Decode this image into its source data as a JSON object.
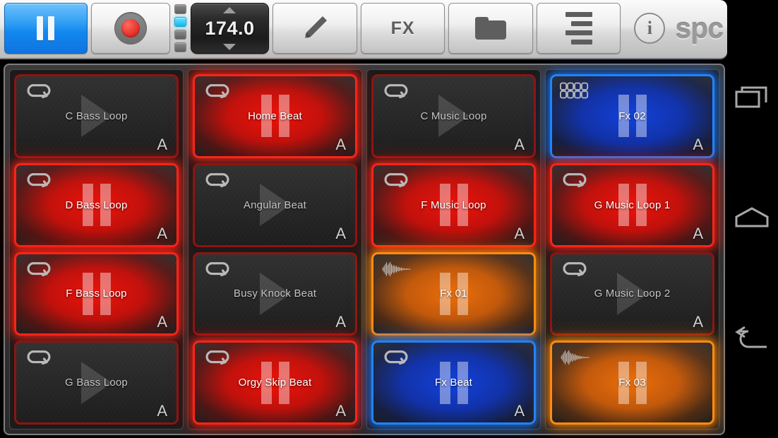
{
  "app": {
    "name": "SPC",
    "logo_text": "spc"
  },
  "toolbar": {
    "transport": {
      "play_pause_state": "pause",
      "play_pause_name": "pause-button",
      "record_name": "record-button"
    },
    "beat_leds": {
      "count": 4,
      "active_index": 1,
      "active_color": "#14b6ea"
    },
    "bpm": {
      "value": "174.0",
      "up_label": "",
      "down_label": ""
    },
    "buttons": [
      {
        "name": "edit-button",
        "icon": "pencil-icon",
        "label": ""
      },
      {
        "name": "fx-button",
        "icon": "fx-icon",
        "label": "FX"
      },
      {
        "name": "files-button",
        "icon": "folder-icon",
        "label": ""
      },
      {
        "name": "menu-button",
        "icon": "hamburger-icon",
        "label": ""
      }
    ],
    "info_label": "i"
  },
  "colors": {
    "red": "#ff2418",
    "blue": "#1f84ff",
    "orange": "#ff8c10",
    "led_cyan": "#14b6ea",
    "accent_blue": "#1288ef"
  },
  "grid": {
    "rows": 4,
    "cols": 4,
    "columns": [
      {
        "name": "pad-column-1",
        "pads": [
          {
            "label": "C Bass Loop",
            "color": "red",
            "active": false,
            "icon": "loop-icon",
            "bank": "A"
          },
          {
            "label": "D Bass Loop",
            "color": "red",
            "active": true,
            "icon": "loop-icon",
            "bank": "A"
          },
          {
            "label": "F Bass Loop",
            "color": "red",
            "active": true,
            "icon": "loop-icon",
            "bank": "A"
          },
          {
            "label": "G Bass Loop",
            "color": "red",
            "active": false,
            "icon": "loop-icon",
            "bank": "A"
          }
        ]
      },
      {
        "name": "pad-column-2",
        "pads": [
          {
            "label": "Home Beat",
            "color": "red",
            "active": true,
            "icon": "loop-icon",
            "bank": "A"
          },
          {
            "label": "Angular Beat",
            "color": "red",
            "active": false,
            "icon": "loop-icon",
            "bank": "A"
          },
          {
            "label": "Busy Knock Beat",
            "color": "red",
            "active": false,
            "icon": "loop-icon",
            "bank": "A"
          },
          {
            "label": "Orgy Skip Beat",
            "color": "red",
            "active": true,
            "icon": "loop-icon",
            "bank": "A"
          }
        ]
      },
      {
        "name": "pad-column-3",
        "pads": [
          {
            "label": "C Music Loop",
            "color": "red",
            "active": false,
            "icon": "loop-icon",
            "bank": "A"
          },
          {
            "label": "F Music Loop",
            "color": "red",
            "active": true,
            "icon": "loop-icon",
            "bank": "A"
          },
          {
            "label": "Fx 01",
            "color": "orange",
            "active": true,
            "icon": "waveform-icon",
            "bank": ""
          },
          {
            "label": "Fx Beat",
            "color": "blue",
            "active": true,
            "icon": "loop-icon",
            "bank": "A"
          }
        ]
      },
      {
        "name": "pad-column-4",
        "pads": [
          {
            "label": "Fx 02",
            "color": "blue",
            "active": true,
            "icon": "matrix-icon",
            "bank": "A"
          },
          {
            "label": "G Music Loop 1",
            "color": "red",
            "active": true,
            "icon": "loop-icon",
            "bank": "A"
          },
          {
            "label": "G Music Loop 2",
            "color": "red",
            "active": false,
            "icon": "loop-icon",
            "bank": "A"
          },
          {
            "label": "Fx 03",
            "color": "orange",
            "active": true,
            "icon": "waveform-icon",
            "bank": ""
          }
        ]
      }
    ]
  },
  "navbar": {
    "recents_label": "",
    "home_label": "",
    "back_label": ""
  }
}
